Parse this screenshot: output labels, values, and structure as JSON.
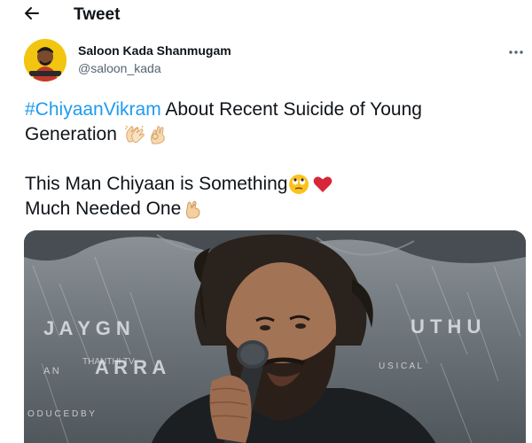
{
  "header": {
    "title": "Tweet",
    "back_icon": "arrow-left-icon"
  },
  "author": {
    "display_name": "Saloon Kada Shanmugam",
    "handle": "@saloon_kada",
    "avatar_color": "#f2c511"
  },
  "tweet": {
    "hashtag": "#ChiyaanVikram",
    "line1_rest": " About Recent Suicide of Young",
    "line2": "Generation",
    "line2_emojis": [
      "clapping-hands-icon",
      "ok-hand-icon"
    ],
    "line3": "This Man Chiyaan is Something",
    "line3_emojis": [
      "face-with-rolling-eyes-icon",
      "red-heart-icon"
    ],
    "line4": "Much Needed One",
    "line4_emojis": [
      "crossed-fingers-icon"
    ]
  },
  "media": {
    "poster_text_1": "J A Y   G N",
    "poster_text_2": "U T H U",
    "poster_text_3": "A R   R A",
    "poster_text_4": "A N",
    "poster_text_5": "U S I C A L",
    "poster_text_6": "O D U C E D   B Y",
    "watermark": "THANTHI TV"
  },
  "colors": {
    "link": "#1d9bf0",
    "text": "#0f1419",
    "secondary": "#536471"
  }
}
